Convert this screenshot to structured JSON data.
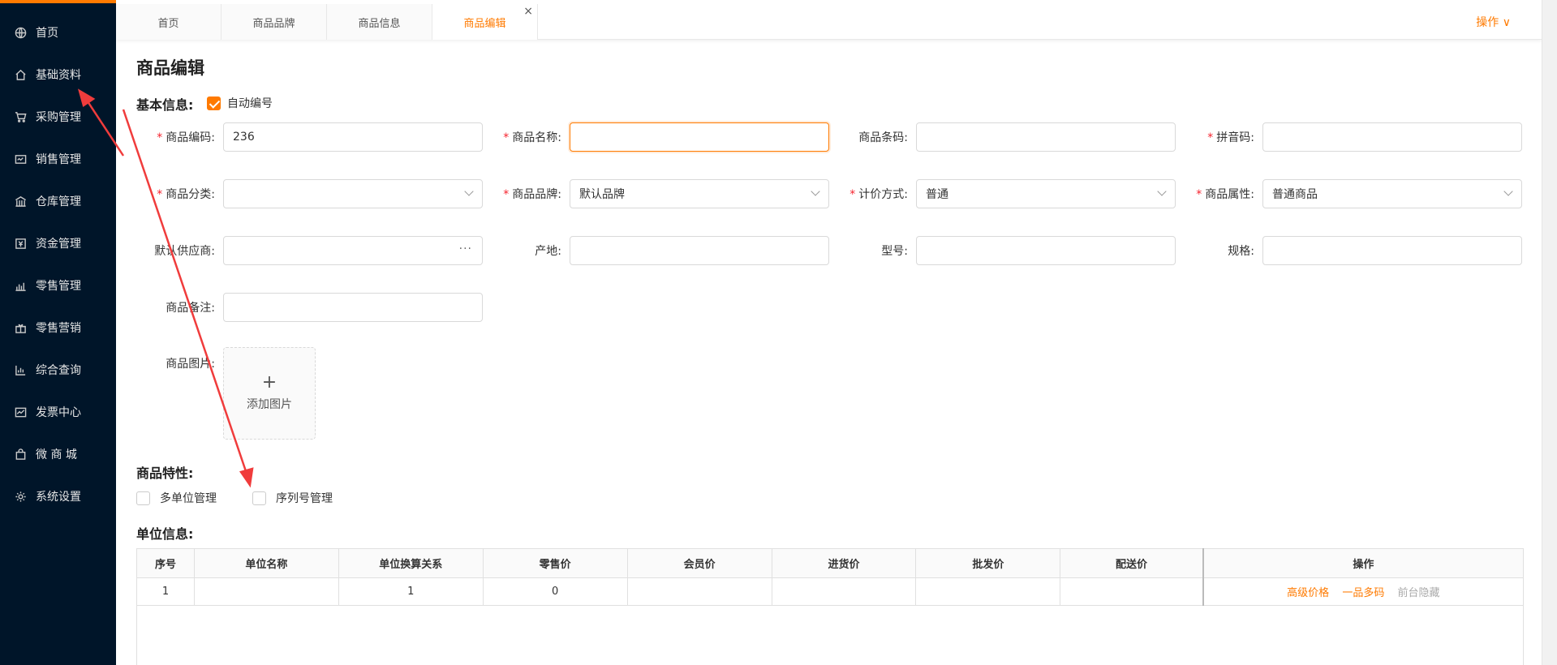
{
  "sidebar": {
    "items": [
      {
        "label": "首页",
        "icon": "globe-icon"
      },
      {
        "label": "基础资料",
        "icon": "home-icon"
      },
      {
        "label": "采购管理",
        "icon": "cart-icon"
      },
      {
        "label": "销售管理",
        "icon": "sales-icon"
      },
      {
        "label": "仓库管理",
        "icon": "warehouse-icon"
      },
      {
        "label": "资金管理",
        "icon": "money-icon"
      },
      {
        "label": "零售管理",
        "icon": "retail-icon"
      },
      {
        "label": "零售营销",
        "icon": "gift-icon"
      },
      {
        "label": "综合查询",
        "icon": "chart-icon"
      },
      {
        "label": "发票中心",
        "icon": "invoice-icon"
      },
      {
        "label": "微 商 城",
        "icon": "shop-icon"
      },
      {
        "label": "系统设置",
        "icon": "gear-icon"
      }
    ]
  },
  "tabs": [
    {
      "label": "首页"
    },
    {
      "label": "商品品牌"
    },
    {
      "label": "商品信息"
    },
    {
      "label": "商品编辑",
      "close": "×"
    }
  ],
  "ops_label": "操作 ∨",
  "page_title": "商品编辑",
  "basic": {
    "title": "基本信息:",
    "auto_code_label": "自动编号",
    "auto_code_checked": true
  },
  "fields": {
    "code": {
      "label": "商品编码:",
      "value": "236"
    },
    "name": {
      "label": "商品名称:",
      "value": ""
    },
    "barcode": {
      "label": "商品条码:",
      "value": ""
    },
    "pinyin": {
      "label": "拼音码:",
      "value": ""
    },
    "category": {
      "label": "商品分类:",
      "value": ""
    },
    "brand": {
      "label": "商品品牌:",
      "value": "默认品牌"
    },
    "pricing": {
      "label": "计价方式:",
      "value": "普通"
    },
    "attr": {
      "label": "商品属性:",
      "value": "普通商品"
    },
    "supplier": {
      "label": "默认供应商:",
      "value": "",
      "more": "···"
    },
    "origin": {
      "label": "产地:",
      "value": ""
    },
    "model": {
      "label": "型号:",
      "value": ""
    },
    "spec": {
      "label": "规格:",
      "value": ""
    },
    "remark": {
      "label": "商品备注:",
      "value": ""
    },
    "image": {
      "label": "商品图片:",
      "plus": "+",
      "upload_label": "添加图片"
    }
  },
  "features": {
    "title": "商品特性:",
    "multi_unit": "多单位管理",
    "serial": "序列号管理"
  },
  "units": {
    "title": "单位信息:",
    "headers": [
      "序号",
      "单位名称",
      "单位换算关系",
      "零售价",
      "会员价",
      "进货价",
      "批发价",
      "配送价",
      "操作"
    ],
    "rows": [
      {
        "no": "1",
        "name": "",
        "ratio": "1",
        "retail": "0",
        "member": "",
        "purchase": "",
        "wholesale": "",
        "delivery": ""
      }
    ],
    "actions": {
      "adv_price": "高级价格",
      "multi_code": "一品多码",
      "hide": "前台隐藏"
    }
  },
  "colors": {
    "accent": "#ff7a00",
    "sidebar_bg": "#001529",
    "required": "#f5222d",
    "annotation": "#f03c3c"
  }
}
